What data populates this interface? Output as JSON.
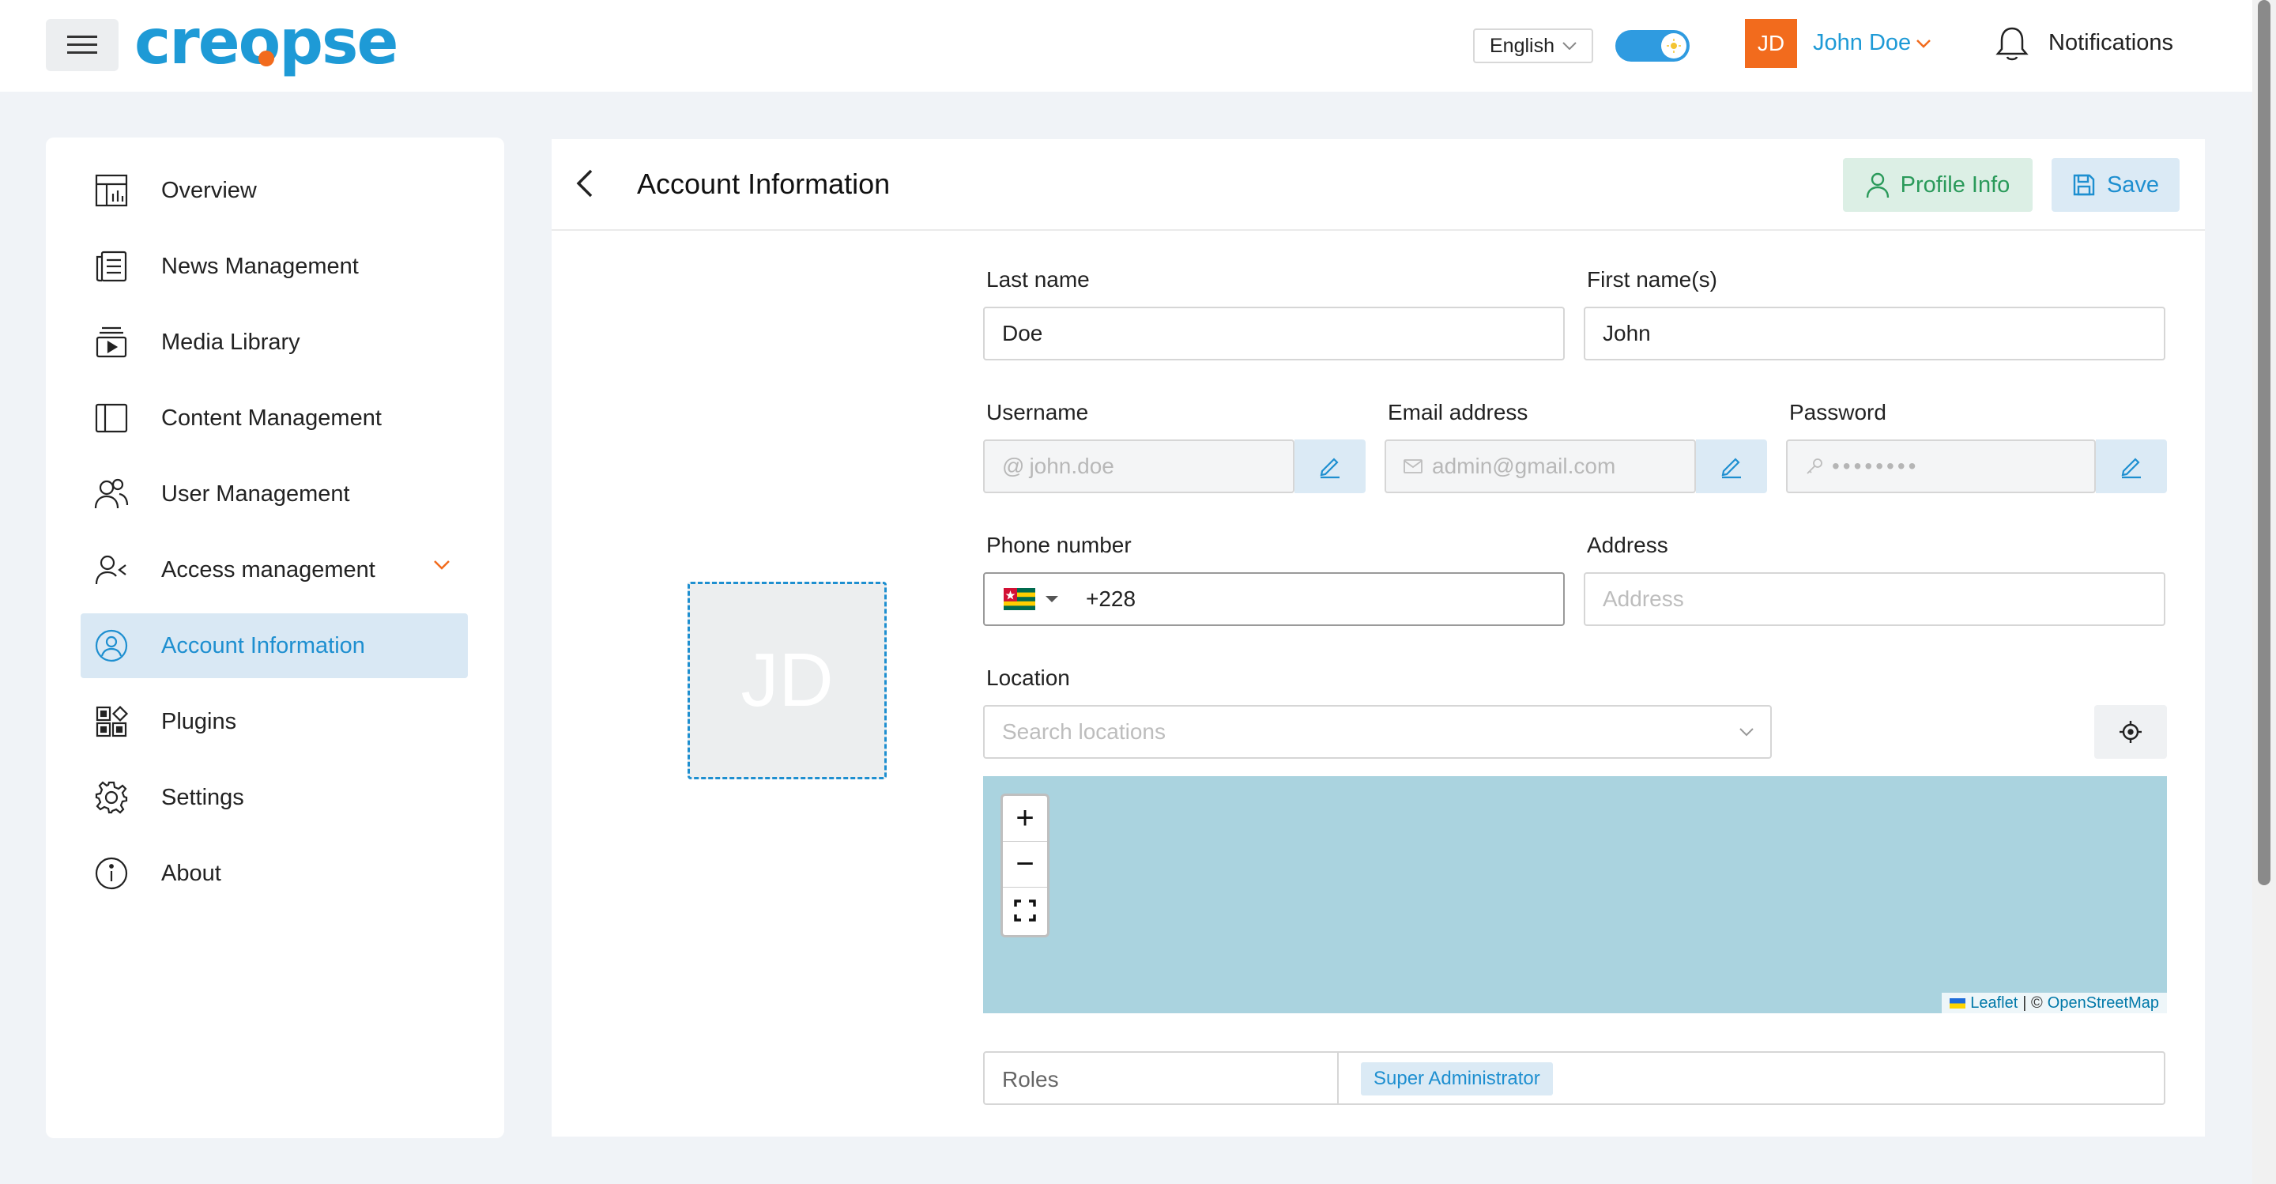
{
  "header": {
    "brand": "creopse",
    "language": "English",
    "user_initials": "JD",
    "user_name": "John Doe",
    "notifications_label": "Notifications"
  },
  "colors": {
    "brand_blue": "#1e9ad6",
    "accent_orange": "#f26b1d",
    "success_green": "#2a9a5a",
    "map_water": "#aad3df"
  },
  "sidebar": {
    "items": [
      {
        "label": "Overview",
        "icon": "dashboard-icon"
      },
      {
        "label": "News Management",
        "icon": "newspaper-icon"
      },
      {
        "label": "Media Library",
        "icon": "media-icon"
      },
      {
        "label": "Content Management",
        "icon": "layout-icon"
      },
      {
        "label": "User Management",
        "icon": "users-icon"
      },
      {
        "label": "Access management",
        "icon": "user-access-icon"
      },
      {
        "label": "Account Information",
        "icon": "account-circle-icon"
      },
      {
        "label": "Plugins",
        "icon": "plugins-icon"
      },
      {
        "label": "Settings",
        "icon": "gear-icon"
      },
      {
        "label": "About",
        "icon": "info-icon"
      }
    ],
    "active": "Account Information"
  },
  "page": {
    "title": "Account Information",
    "profile_info_label": "Profile Info",
    "save_label": "Save",
    "photo_initials": "JD"
  },
  "form": {
    "last_name": {
      "label": "Last name",
      "value": "Doe"
    },
    "first_name": {
      "label": "First name(s)",
      "value": "John"
    },
    "username": {
      "label": "Username",
      "value": "john.doe"
    },
    "email": {
      "label": "Email address",
      "value": "admin@gmail.com"
    },
    "password": {
      "label": "Password",
      "value": "••••••••"
    },
    "phone": {
      "label": "Phone number",
      "value": "+228"
    },
    "address": {
      "label": "Address",
      "placeholder": "Address"
    },
    "location": {
      "label": "Location",
      "placeholder": "Search locations"
    },
    "roles": {
      "label": "Roles",
      "value": "Super Administrator"
    }
  },
  "map": {
    "zoom_in": "+",
    "zoom_out": "−",
    "attribution_leaflet": "Leaflet",
    "attribution_sep": "| ©",
    "attribution_osm": "OpenStreetMap"
  }
}
